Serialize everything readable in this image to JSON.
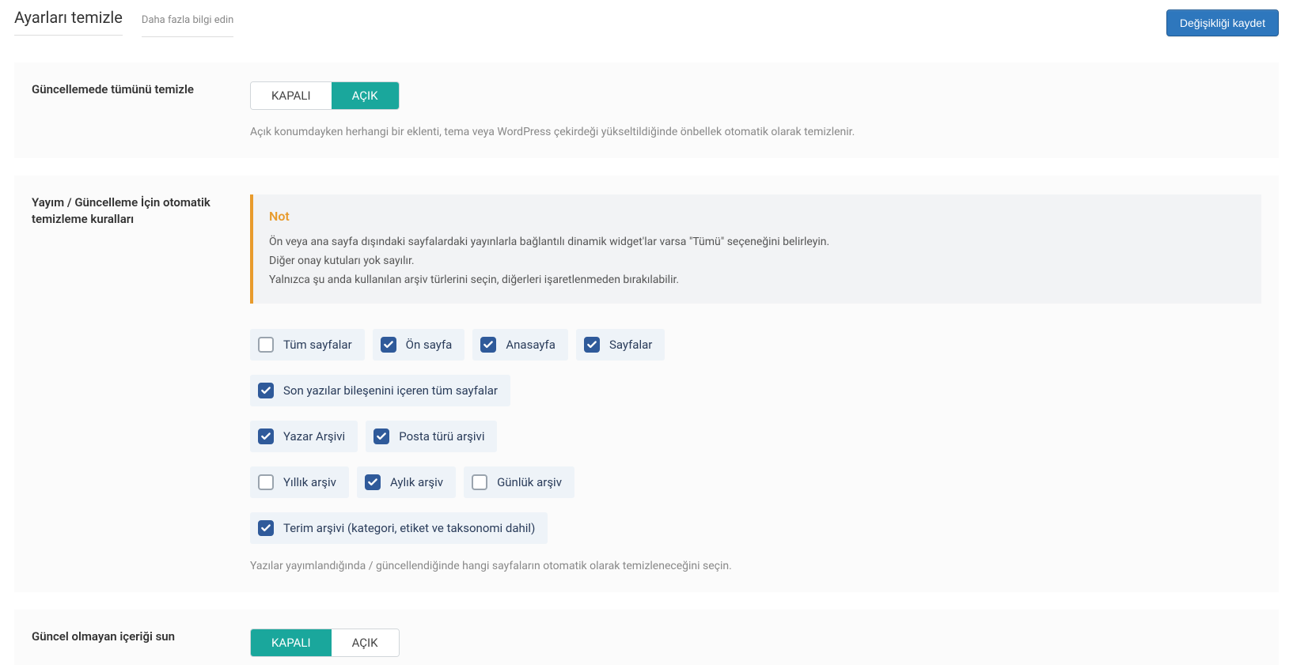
{
  "header": {
    "title": "Ayarları temizle",
    "learn_more": "Daha fazla bilgi edin",
    "save": "Değişikliği kaydet"
  },
  "toggle": {
    "off": "KAPALI",
    "on": "AÇIK"
  },
  "section1": {
    "label": "Güncellemede tümünü temizle",
    "state": "on",
    "desc": "Açık konumdayken herhangi bir eklenti, tema veya WordPress çekirdeği yükseltildiğinde önbellek otomatik olarak temizlenir."
  },
  "section2": {
    "label": "Yayım / Güncelleme İçin otomatik temizleme kuralları",
    "note_title": "Not",
    "note_lines": [
      "Ön veya ana sayfa dışındaki sayfalardaki yayınlarla bağlantılı dinamik widget'lar varsa \"Tümü\" seçeneğini belirleyin.",
      "Diğer onay kutuları yok sayılır.",
      "Yalnızca şu anda kullanılan arşiv türlerini seçin, diğerleri işaretlenmeden bırakılabilir."
    ],
    "rows": [
      [
        {
          "label": "Tüm sayfalar",
          "checked": false
        },
        {
          "label": "Ön sayfa",
          "checked": true
        },
        {
          "label": "Anasayfa",
          "checked": true
        },
        {
          "label": "Sayfalar",
          "checked": true
        }
      ],
      [
        {
          "label": "Son yazılar bileşenini içeren tüm sayfalar",
          "checked": true
        }
      ],
      [
        {
          "label": "Yazar Arşivi",
          "checked": true
        },
        {
          "label": "Posta türü arşivi",
          "checked": true
        }
      ],
      [
        {
          "label": "Yıllık arşiv",
          "checked": false
        },
        {
          "label": "Aylık arşiv",
          "checked": true
        },
        {
          "label": "Günlük arşiv",
          "checked": false
        }
      ],
      [
        {
          "label": "Terim arşivi (kategori, etiket ve taksonomi dahil)",
          "checked": true
        }
      ]
    ],
    "desc": "Yazılar yayımlandığında / güncellendiğinde hangi sayfaların otomatik olarak temizleneceğini seçin."
  },
  "section3": {
    "label": "Güncel olmayan içeriği sun",
    "state": "off"
  }
}
